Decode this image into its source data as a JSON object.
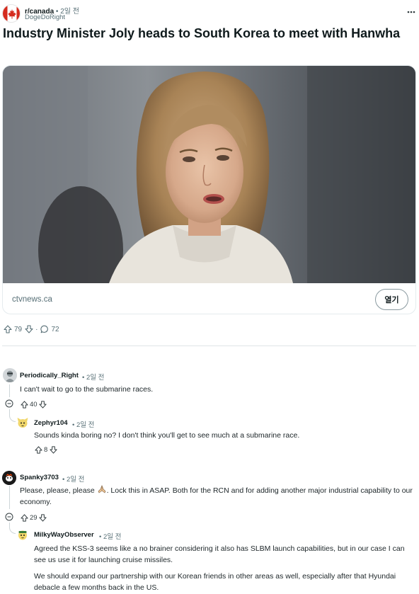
{
  "post": {
    "subreddit": "r/canada",
    "separator": "•",
    "time": "2일 전",
    "author": "DogeDoRight",
    "title": "Industry Minister Joly heads to South Korea to meet with Hanwha",
    "link_domain": "ctvnews.ca",
    "open_label": "열기",
    "upvotes": "79",
    "comment_separator": "·",
    "comment_count": "72",
    "icons": [
      "canada-flag-icon",
      "overflow-menu-icon",
      "upvote-icon",
      "downvote-icon",
      "comment-icon"
    ]
  },
  "comments": [
    {
      "author": "Periodically_Right",
      "time": "• 2일 전",
      "body": "I can't wait to go to the submarine races.",
      "votes": "40"
    },
    {
      "author": "Zephyr104",
      "time": "• 2일 전",
      "body": "Sounds kinda boring no? I don't think you'll get to see much at a submarine race.",
      "votes": "8"
    },
    {
      "author": "Spanky3703",
      "time": "• 2일 전",
      "body_before_emoji": "Please, please, please ",
      "body_after_emoji": ". Lock this in ASAP. Both for the RCN and for adding another major industrial capability to our economy.",
      "votes": "29"
    },
    {
      "author": "MilkyWayObserver",
      "time": "• 2일 전",
      "paragraph1": "Agreed the KSS-3 seems like a no brainer considering it also has SLBM launch capabilities, but in our case I can see us use it for launching cruise missiles.",
      "paragraph2": "We should expand our partnership with our Korean friends in other areas as well, especially after that Hyundai debacle a few months back in the US."
    }
  ],
  "colors": {
    "text": "#0f1a1c",
    "meta": "#576f76",
    "thread_line": "#cdd5d8",
    "canada_red": "#d52b1e"
  }
}
